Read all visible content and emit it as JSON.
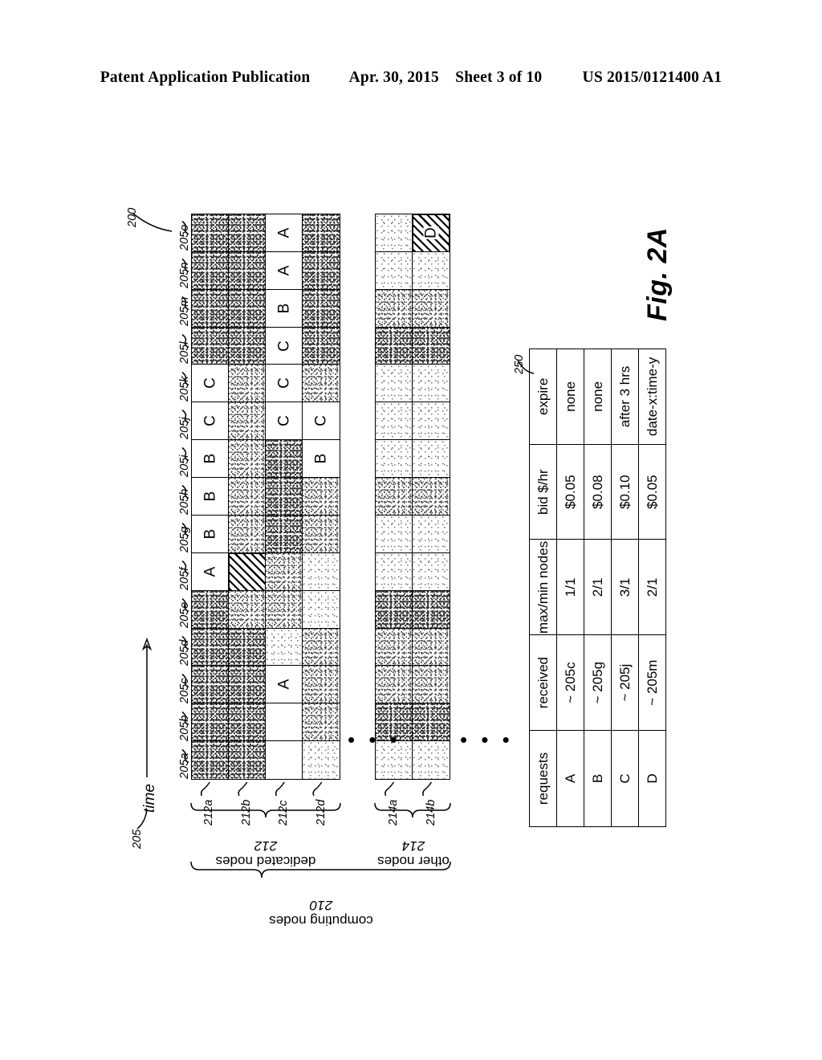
{
  "header": {
    "publication": "Patent Application Publication",
    "date": "Apr. 30, 2015",
    "sheet": "Sheet 3 of 10",
    "docnum": "US 2015/0121400 A1"
  },
  "figure": {
    "caption": "Fig. 2A",
    "diagram_ref": "200",
    "timeline_ref": "205",
    "time_axis_label": "time"
  },
  "timeline": {
    "slots": [
      "205a",
      "205b",
      "205c",
      "205d",
      "205e",
      "205f",
      "205g",
      "205h",
      "205i",
      "205j",
      "205k",
      "205l",
      "205m",
      "205n",
      "205o"
    ]
  },
  "groups": {
    "computing_nodes": {
      "label": "computing nodes",
      "ref": "210"
    },
    "dedicated_nodes": {
      "label": "dedicated nodes",
      "ref": "212"
    },
    "other_nodes": {
      "label": "other nodes",
      "ref": "214"
    }
  },
  "dedicated_grid": {
    "row_labels": [
      "212a",
      "212b",
      "212c",
      "212d"
    ],
    "rows": [
      {
        "label": "212a",
        "cells": [
          {
            "fill": "shaded",
            "shade": "dark",
            "text": ""
          },
          {
            "fill": "shaded",
            "shade": "dark",
            "text": ""
          },
          {
            "fill": "shaded",
            "shade": "dark",
            "text": ""
          },
          {
            "fill": "shaded",
            "shade": "dark",
            "text": ""
          },
          {
            "fill": "shaded",
            "shade": "dark",
            "text": ""
          },
          {
            "fill": "none",
            "shade": "",
            "text": "A"
          },
          {
            "fill": "none",
            "shade": "",
            "text": "B"
          },
          {
            "fill": "none",
            "shade": "",
            "text": "B"
          },
          {
            "fill": "none",
            "shade": "",
            "text": "B"
          },
          {
            "fill": "none",
            "shade": "",
            "text": "C"
          },
          {
            "fill": "none",
            "shade": "",
            "text": "C"
          },
          {
            "fill": "shaded",
            "shade": "dark",
            "text": ""
          },
          {
            "fill": "shaded",
            "shade": "dark",
            "text": ""
          },
          {
            "fill": "shaded",
            "shade": "dark",
            "text": ""
          },
          {
            "fill": "shaded",
            "shade": "dark",
            "text": ""
          }
        ]
      },
      {
        "label": "212b",
        "cells": [
          {
            "fill": "shaded",
            "shade": "dark",
            "text": ""
          },
          {
            "fill": "shaded",
            "shade": "dark",
            "text": ""
          },
          {
            "fill": "shaded",
            "shade": "dark",
            "text": ""
          },
          {
            "fill": "shaded",
            "shade": "dark",
            "text": ""
          },
          {
            "fill": "shaded",
            "shade": "",
            "text": ""
          },
          {
            "fill": "hatched",
            "shade": "",
            "text": ""
          },
          {
            "fill": "shaded",
            "shade": "",
            "text": ""
          },
          {
            "fill": "shaded",
            "shade": "",
            "text": ""
          },
          {
            "fill": "shaded",
            "shade": "",
            "text": ""
          },
          {
            "fill": "shaded",
            "shade": "",
            "text": ""
          },
          {
            "fill": "shaded",
            "shade": "",
            "text": ""
          },
          {
            "fill": "shaded",
            "shade": "dark",
            "text": ""
          },
          {
            "fill": "shaded",
            "shade": "dark",
            "text": ""
          },
          {
            "fill": "shaded",
            "shade": "dark",
            "text": ""
          },
          {
            "fill": "shaded",
            "shade": "dark",
            "text": ""
          }
        ]
      },
      {
        "label": "212c",
        "cells": [
          {
            "fill": "none",
            "shade": "",
            "text": ""
          },
          {
            "fill": "none",
            "shade": "",
            "text": ""
          },
          {
            "fill": "none",
            "shade": "",
            "text": "A"
          },
          {
            "fill": "shaded",
            "shade": "light",
            "text": ""
          },
          {
            "fill": "shaded",
            "shade": "",
            "text": ""
          },
          {
            "fill": "shaded",
            "shade": "",
            "text": ""
          },
          {
            "fill": "shaded",
            "shade": "dark",
            "text": ""
          },
          {
            "fill": "shaded",
            "shade": "dark",
            "text": ""
          },
          {
            "fill": "shaded",
            "shade": "dark",
            "text": ""
          },
          {
            "fill": "none",
            "shade": "",
            "text": "C"
          },
          {
            "fill": "none",
            "shade": "",
            "text": "C"
          },
          {
            "fill": "none",
            "shade": "",
            "text": "C"
          },
          {
            "fill": "none",
            "shade": "",
            "text": "B"
          },
          {
            "fill": "none",
            "shade": "",
            "text": "A"
          },
          {
            "fill": "none",
            "shade": "",
            "text": "A"
          }
        ]
      },
      {
        "label": "212d",
        "cells": [
          {
            "fill": "shaded",
            "shade": "light",
            "text": ""
          },
          {
            "fill": "shaded",
            "shade": "",
            "text": ""
          },
          {
            "fill": "shaded",
            "shade": "",
            "text": ""
          },
          {
            "fill": "shaded",
            "shade": "",
            "text": ""
          },
          {
            "fill": "shaded",
            "shade": "light",
            "text": ""
          },
          {
            "fill": "shaded",
            "shade": "light",
            "text": ""
          },
          {
            "fill": "shaded",
            "shade": "",
            "text": ""
          },
          {
            "fill": "shaded",
            "shade": "",
            "text": ""
          },
          {
            "fill": "none",
            "shade": "",
            "text": "B"
          },
          {
            "fill": "none",
            "shade": "",
            "text": "C"
          },
          {
            "fill": "shaded",
            "shade": "",
            "text": ""
          },
          {
            "fill": "shaded",
            "shade": "dark",
            "text": ""
          },
          {
            "fill": "shaded",
            "shade": "dark",
            "text": ""
          },
          {
            "fill": "shaded",
            "shade": "dark",
            "text": ""
          },
          {
            "fill": "shaded",
            "shade": "dark",
            "text": ""
          }
        ]
      }
    ]
  },
  "other_grid": {
    "row_labels": [
      "214a",
      "214b"
    ],
    "rows": [
      {
        "label": "214a",
        "cells": [
          {
            "fill": "shaded",
            "shade": "light",
            "text": ""
          },
          {
            "fill": "shaded",
            "shade": "dark",
            "text": ""
          },
          {
            "fill": "shaded",
            "shade": "",
            "text": ""
          },
          {
            "fill": "shaded",
            "shade": "",
            "text": ""
          },
          {
            "fill": "shaded",
            "shade": "dark",
            "text": ""
          },
          {
            "fill": "shaded",
            "shade": "light",
            "text": ""
          },
          {
            "fill": "shaded",
            "shade": "light",
            "text": ""
          },
          {
            "fill": "shaded",
            "shade": "",
            "text": ""
          },
          {
            "fill": "shaded",
            "shade": "light",
            "text": ""
          },
          {
            "fill": "shaded",
            "shade": "light",
            "text": ""
          },
          {
            "fill": "shaded",
            "shade": "light",
            "text": ""
          },
          {
            "fill": "shaded",
            "shade": "dark",
            "text": ""
          },
          {
            "fill": "shaded",
            "shade": "",
            "text": ""
          },
          {
            "fill": "shaded",
            "shade": "light",
            "text": ""
          },
          {
            "fill": "shaded",
            "shade": "light",
            "text": ""
          }
        ]
      },
      {
        "label": "214b",
        "cells": [
          {
            "fill": "shaded",
            "shade": "light",
            "text": ""
          },
          {
            "fill": "shaded",
            "shade": "dark",
            "text": ""
          },
          {
            "fill": "shaded",
            "shade": "",
            "text": ""
          },
          {
            "fill": "shaded",
            "shade": "",
            "text": ""
          },
          {
            "fill": "shaded",
            "shade": "dark",
            "text": ""
          },
          {
            "fill": "shaded",
            "shade": "light",
            "text": ""
          },
          {
            "fill": "shaded",
            "shade": "light",
            "text": ""
          },
          {
            "fill": "shaded",
            "shade": "",
            "text": ""
          },
          {
            "fill": "shaded",
            "shade": "light",
            "text": ""
          },
          {
            "fill": "shaded",
            "shade": "light",
            "text": ""
          },
          {
            "fill": "shaded",
            "shade": "light",
            "text": ""
          },
          {
            "fill": "shaded",
            "shade": "dark",
            "text": ""
          },
          {
            "fill": "shaded",
            "shade": "",
            "text": ""
          },
          {
            "fill": "shaded",
            "shade": "light",
            "text": ""
          },
          {
            "fill": "hatched",
            "shade": "",
            "text": "D"
          }
        ]
      }
    ]
  },
  "ellipsis": {
    "glyph": "• • •"
  },
  "request_table": {
    "ref": "250",
    "columns": [
      "requests",
      "received",
      "max/min nodes",
      "bid $/hr",
      "expire"
    ],
    "rows": [
      {
        "requests": "A",
        "received": "~ 205c",
        "nodes": "1/1",
        "bid": "$0.05",
        "expire": "none"
      },
      {
        "requests": "B",
        "received": "~ 205g",
        "nodes": "2/1",
        "bid": "$0.08",
        "expire": "none"
      },
      {
        "requests": "C",
        "received": "~ 205j",
        "nodes": "3/1",
        "bid": "$0.10",
        "expire": "after 3 hrs"
      },
      {
        "requests": "D",
        "received": "~ 205m",
        "nodes": "2/1",
        "bid": "$0.05",
        "expire": "date-x:time-y"
      }
    ]
  }
}
